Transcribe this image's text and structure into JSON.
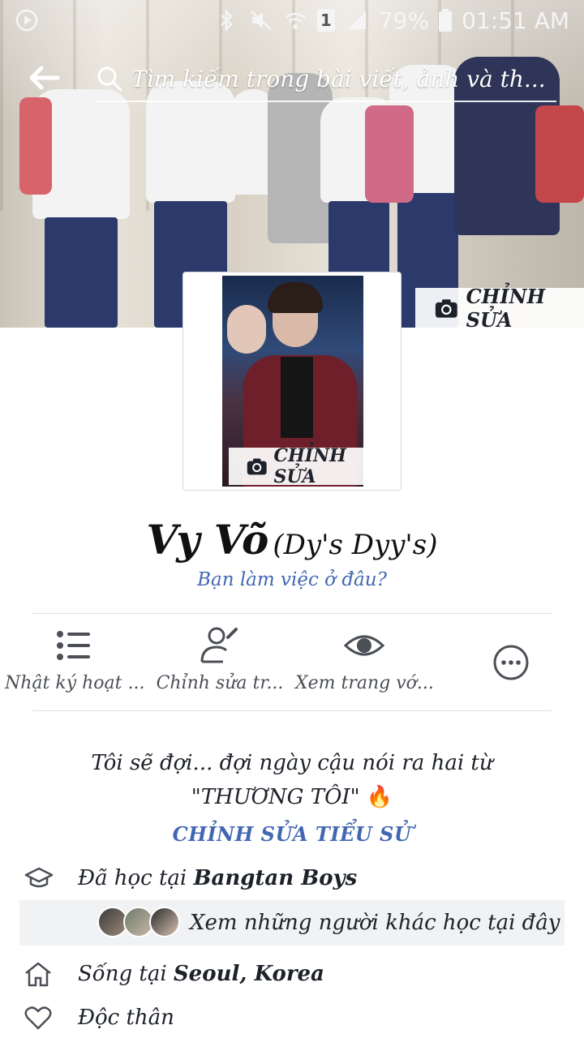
{
  "status_bar": {
    "battery": "79%",
    "time": "01:51 AM",
    "sim_slot": "1"
  },
  "search": {
    "placeholder": "Tìm kiếm trong bài viết, ảnh và th..."
  },
  "cover": {
    "edit_label": "CHỈNH SỬA"
  },
  "avatar": {
    "edit_label": "CHỈNH SỬA"
  },
  "profile": {
    "name": "Vy Võ",
    "alternate_name": "(Dy's Dyy's)",
    "work_prompt": "Bạn làm việc ở đâu?"
  },
  "actions": [
    {
      "label": "Nhật ký hoạt ...",
      "icon": "list-icon"
    },
    {
      "label": "Chỉnh sửa tr...",
      "icon": "edit-profile-icon"
    },
    {
      "label": "Xem trang vớ...",
      "icon": "eye-icon"
    },
    {
      "label": "",
      "icon": "more-icon"
    }
  ],
  "bio": {
    "line1": "Tôi sẽ đợi... đợi ngày cậu nói ra hai từ",
    "line2": "\"THƯƠNG TÔI\"",
    "emoji": "🔥",
    "edit_label": "CHỈNH SỬA TIỂU SỬ"
  },
  "details": {
    "education_prefix": "Đã học tại",
    "education_place": "Bangtan Boys",
    "classmates_link": "Xem những người khác học tại đây",
    "lives_prefix": "Sống tại",
    "lives_place": "Seoul, Korea",
    "relationship": "Độc thân"
  },
  "colors": {
    "link_blue": "#4267b2",
    "text_dark": "#1d2129",
    "icon_gray": "#4b4f56"
  }
}
